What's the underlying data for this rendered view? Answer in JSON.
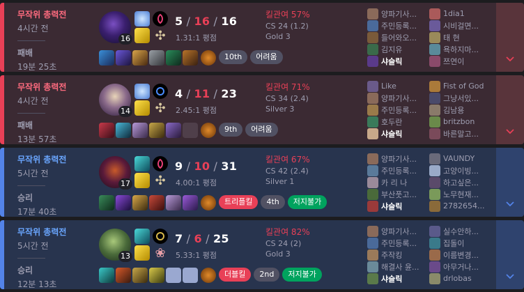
{
  "matches": [
    {
      "result_type": "loss",
      "queue": "무작위 총력전",
      "ago": "4시간 전",
      "result": "패배",
      "duration": "19분 25초",
      "level": "16",
      "kda": {
        "k": "5",
        "d": "16",
        "a": "16"
      },
      "ratio": "1.31:1 평점",
      "kp": "킬관여 57%",
      "cs": "CS 24 (1.2)",
      "tier": "Gold 3",
      "badges": [
        {
          "text": "10th",
          "style": "gray"
        },
        {
          "text": "어려움",
          "style": "gray"
        }
      ],
      "team1": [
        "양파기사...",
        "주민등록...",
        "들어와오...",
        "김지유",
        "샤슬릭"
      ],
      "team2": [
        "1dia1",
        "시비걸면...",
        "태 현",
        "욕하지마...",
        "쯔연이"
      ]
    },
    {
      "result_type": "loss",
      "queue": "무작위 총력전",
      "ago": "4시간 전",
      "result": "패배",
      "duration": "13분 57초",
      "level": "14",
      "kda": {
        "k": "4",
        "d": "11",
        "a": "23"
      },
      "ratio": "2.45:1 평점",
      "kp": "킬관여 71%",
      "cs": "CS 34 (2.4)",
      "tier": "Silver 3",
      "badges": [
        {
          "text": "9th",
          "style": "gray"
        },
        {
          "text": "어려움",
          "style": "gray"
        }
      ],
      "team1": [
        "Like",
        "양파기사...",
        "주민등록...",
        "호두란",
        "샤슬릭"
      ],
      "team2": [
        "Fist of God",
        "그냥서있...",
        "김남용",
        "britzbon",
        "바른말고..."
      ]
    },
    {
      "result_type": "win",
      "queue": "무작위 총력전",
      "ago": "5시간 전",
      "result": "승리",
      "duration": "17분 40초",
      "level": "17",
      "kda": {
        "k": "9",
        "d": "10",
        "a": "31"
      },
      "ratio": "4.00:1 평점",
      "kp": "킬관여 67%",
      "cs": "CS 42 (2.4)",
      "tier": "Silver 1",
      "badges": [
        {
          "text": "트리플킬",
          "style": "red"
        },
        {
          "text": "4th",
          "style": "gray"
        },
        {
          "text": "저지불가",
          "style": "green"
        }
      ],
      "team1": [
        "양파기사...",
        "주민등록...",
        "카 리 나",
        "부산풋고...",
        "샤슬릭"
      ],
      "team2": [
        "VAUNDY",
        "고양이빙...",
        "하고싶은...",
        "노무현재...",
        "2782654..."
      ]
    },
    {
      "result_type": "win",
      "queue": "무작위 총력전",
      "ago": "5시간 전",
      "result": "승리",
      "duration": "12분 13초",
      "level": "13",
      "kda": {
        "k": "7",
        "d": "6",
        "a": "25"
      },
      "ratio": "5.33:1 평점",
      "kp": "킬관여 82%",
      "cs": "CS 24 (2)",
      "tier": "Gold 3",
      "badges": [
        {
          "text": "더블킬",
          "style": "red"
        },
        {
          "text": "2nd",
          "style": "gray"
        },
        {
          "text": "저지불가",
          "style": "green"
        }
      ],
      "team1": [
        "양파기사...",
        "주민등록...",
        "주작킹",
        "해결사 윤...",
        "샤슬릭"
      ],
      "team2": [
        "실수안하...",
        "집돌이",
        "이름변경...",
        "아무거나...",
        "drlobas"
      ]
    }
  ],
  "icons": {
    "expand": "chevron-down-icon",
    "champion": "champion-portrait",
    "spell": "summoner-spell-icon",
    "rune": "rune-icon",
    "item": "item-icon",
    "ward": "ward-icon"
  },
  "colors": {
    "loss": "#e84057",
    "win": "#5383e8",
    "loss_bg": "#3b2a33",
    "win_bg": "#28344e",
    "green_badge": "#00a35e"
  }
}
